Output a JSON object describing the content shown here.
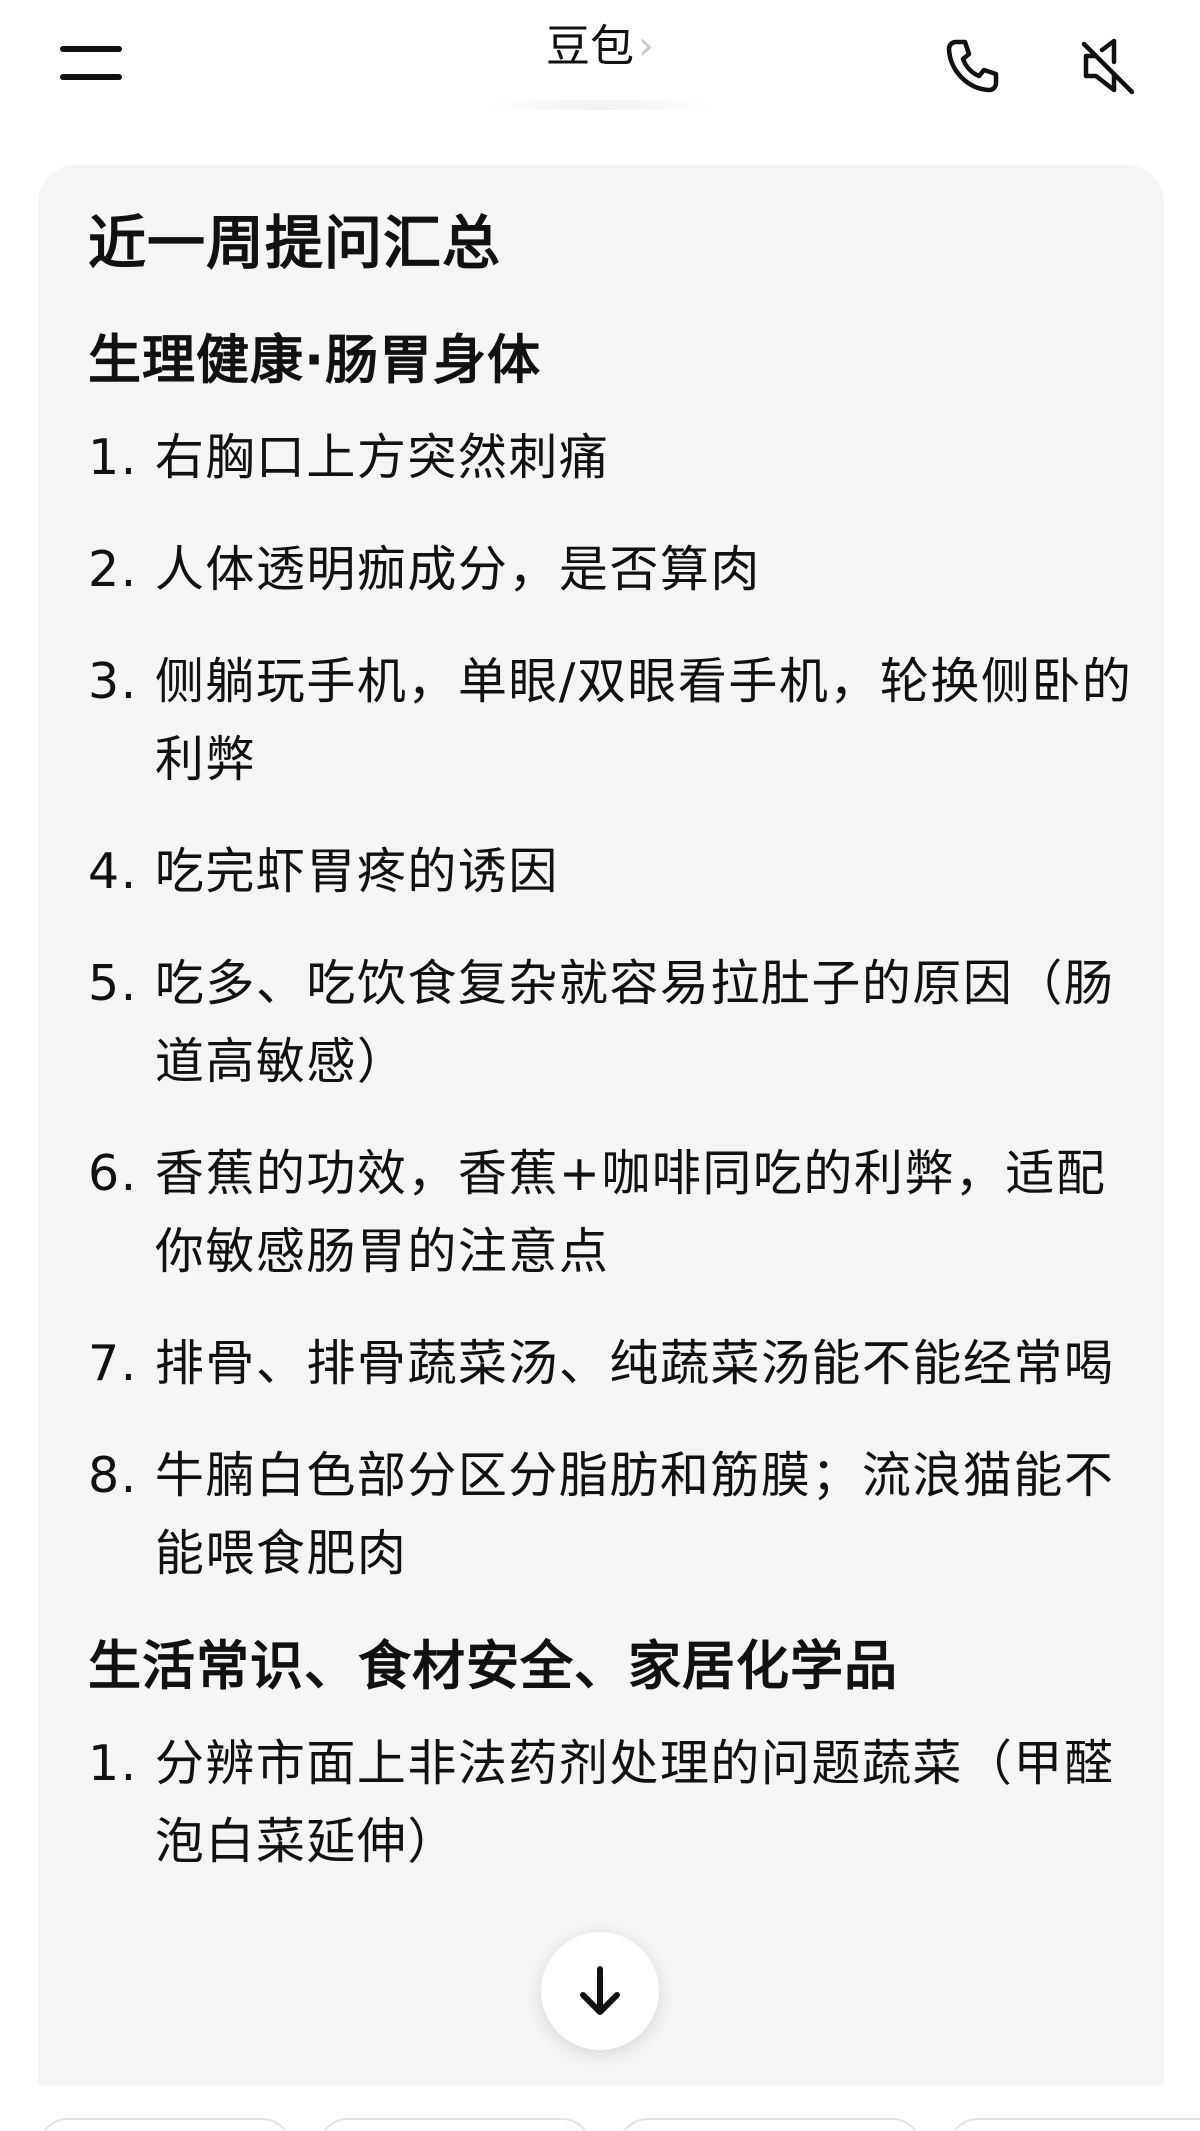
{
  "header": {
    "title": "豆包",
    "title_chevron": "›",
    "menu_icon": "hamburger-menu-icon",
    "call_icon": "phone-icon",
    "mute_icon": "speaker-muted-icon"
  },
  "message": {
    "heading": "近一周提问汇总",
    "sections": [
      {
        "title": "生理健康·肠胃身体",
        "items": [
          {
            "num": "1. ",
            "text": "右胸口上方突然刺痛"
          },
          {
            "num": "2. ",
            "text": "人体透明痂成分，是否算肉"
          },
          {
            "num": "3. ",
            "text": "侧躺玩手机，单眼/双眼看手机，轮换侧卧的利弊"
          },
          {
            "num": "4. ",
            "text": "吃完虾胃疼的诱因"
          },
          {
            "num": "5. ",
            "text": "吃多、吃饮食复杂就容易拉肚子的原因（肠道高敏感）"
          },
          {
            "num": "6. ",
            "text": "香蕉的功效，香蕉+咖啡同吃的利弊，适配你敏感肠胃的注意点"
          },
          {
            "num": "7. ",
            "text": "排骨、排骨蔬菜汤、纯蔬菜汤能不能经常喝"
          },
          {
            "num": "8. ",
            "text": "牛腩白色部分区分脂肪和筋膜；流浪猫能不能喂食肥肉"
          }
        ]
      },
      {
        "title": "生活常识、食材安全、家居化学品",
        "items": [
          {
            "num": "1. ",
            "text": "分辨市面上非法药剂处理的问题蔬菜（甲醛泡白菜延伸）"
          }
        ]
      }
    ]
  },
  "scroll_button_icon": "arrow-down-icon",
  "colors": {
    "card_background": "#f5f5f5",
    "text": "#111111",
    "chevron": "#c9c9c9"
  }
}
